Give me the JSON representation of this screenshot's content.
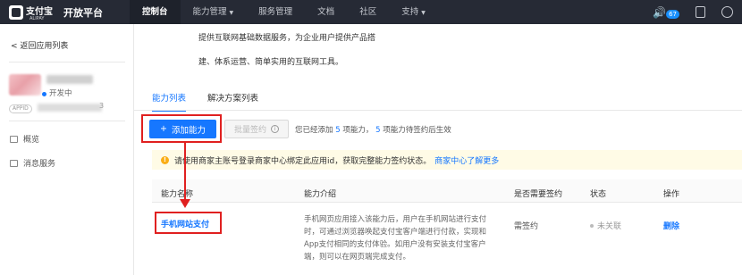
{
  "topbar": {
    "brand_cn": "支付宝",
    "brand_en": "ALIPAY",
    "title": "开放平台",
    "nav": [
      {
        "label": "控制台",
        "dropdown": false,
        "active": true
      },
      {
        "label": "能力管理",
        "dropdown": true,
        "active": false
      },
      {
        "label": "服务管理",
        "dropdown": false,
        "active": false
      },
      {
        "label": "文档",
        "dropdown": false,
        "active": false
      },
      {
        "label": "社区",
        "dropdown": false,
        "active": false
      },
      {
        "label": "支持",
        "dropdown": true,
        "active": false
      }
    ],
    "notification_count": "67"
  },
  "sidebar": {
    "back_label": "返回应用列表",
    "status": "开发中",
    "appid_tag": "APPID",
    "appid_tail": "3",
    "items": [
      {
        "label": "概览",
        "icon": "overview-icon"
      },
      {
        "label": "消息服务",
        "icon": "message-icon"
      }
    ]
  },
  "main": {
    "desc_line1": "提供互联网基础数据服务，为企业用户提供产品搭",
    "desc_line2": "建、体系运营、简单实用的互联网工具。",
    "tabs": [
      {
        "label": "能力列表",
        "active": true
      },
      {
        "label": "解决方案列表",
        "active": false
      }
    ],
    "add_button": "添加能力",
    "batch_button": "批量签约",
    "added_prefix": "您已经添加",
    "added_count": "5",
    "added_mid": "项能力，",
    "pending_count": "5",
    "added_suffix": "项能力待签约后生效",
    "notice_text": "请使用商家主账号登录商家中心绑定此应用id，获取完整能力签约状态。",
    "notice_link": "商家中心了解更多",
    "table": {
      "headers": [
        "能力名称",
        "能力介绍",
        "是否需要签约",
        "状态",
        "操作"
      ],
      "rows": [
        {
          "name": "手机网站支付",
          "intro": "手机网页应用接入该能力后，用户在手机网站进行支付时，可通过浏览器唤起支付宝客户端进行付款，实现和App支付相同的支付体验。如用户没有安装支付宝客户端，则可以在网页端完成支付。",
          "sign": "需签约",
          "status": "未关联",
          "action": "删除"
        }
      ]
    }
  }
}
